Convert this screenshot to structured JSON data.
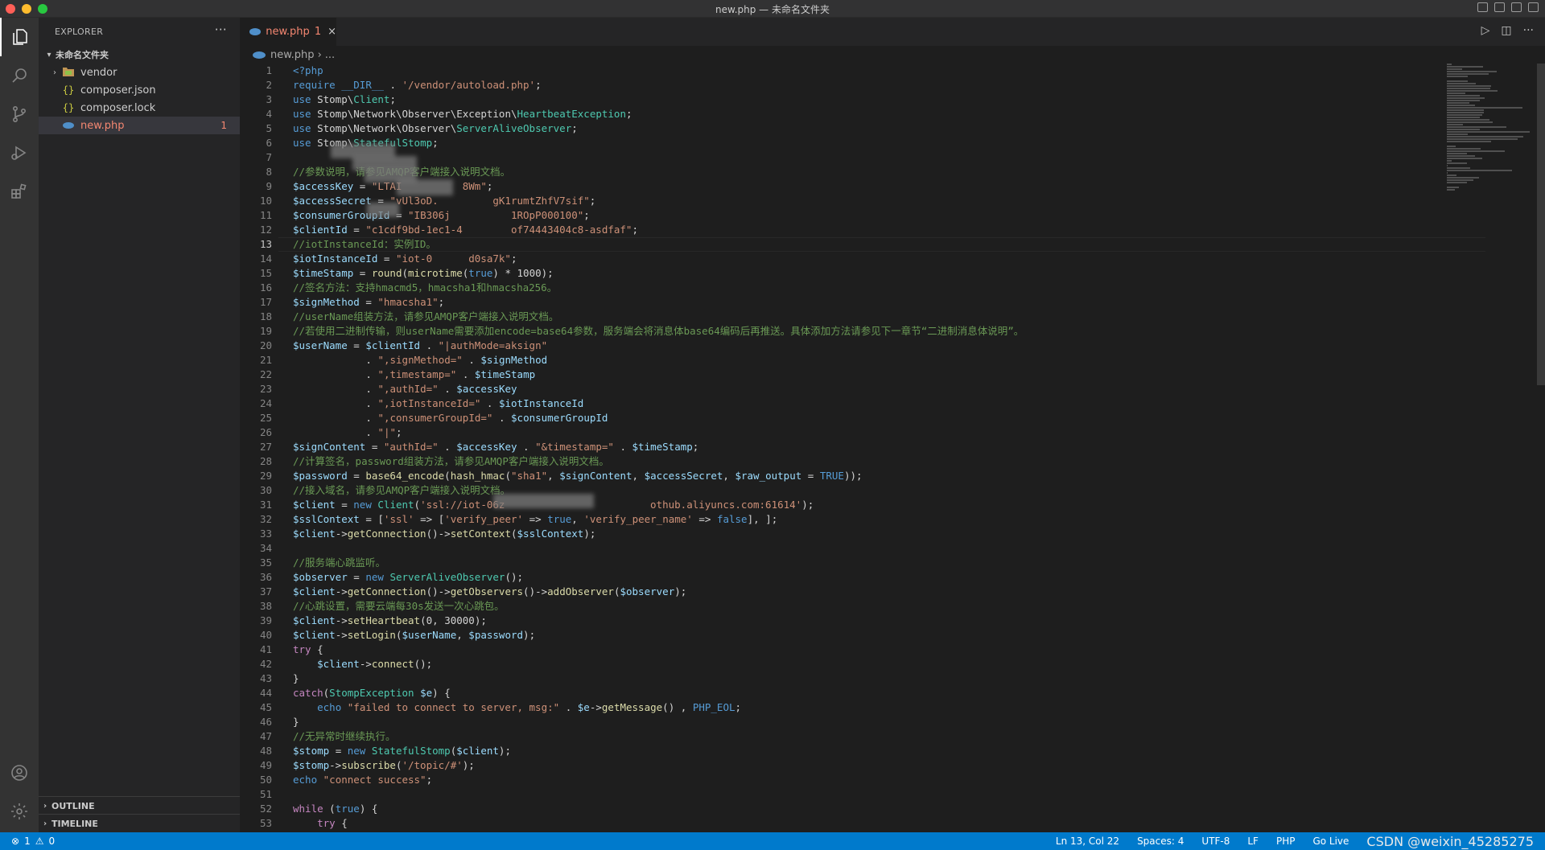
{
  "window": {
    "title": "new.php — 未命名文件夹"
  },
  "explorer": {
    "header": "EXPLORER",
    "more": "···",
    "folder": "未命名文件夹",
    "items": [
      {
        "label": "vendor",
        "type": "folder"
      },
      {
        "label": "composer.json",
        "type": "json"
      },
      {
        "label": "composer.lock",
        "type": "json"
      },
      {
        "label": "new.php",
        "type": "php",
        "badge": "1"
      }
    ],
    "outline": "OUTLINE",
    "timeline": "TIMELINE"
  },
  "tab": {
    "label": "new.php",
    "badge": "1",
    "close": "×"
  },
  "breadcrumb": {
    "file": "new.php",
    "rest": "..."
  },
  "editor": {
    "current_line": 13
  },
  "code": [
    "<?php",
    "require __DIR__ . '/vendor/autoload.php';",
    "use Stomp\\Client;",
    "use Stomp\\Network\\Observer\\Exception\\HeartbeatException;",
    "use Stomp\\Network\\Observer\\ServerAliveObserver;",
    "use Stomp\\StatefulStomp;",
    "",
    "//参数说明，请参见AMQP客户端接入说明文档。",
    "$accessKey = \"LTAI          8Wm\";",
    "$accessSecret = \"vUl3oD.         gK1rumtZhfV7sif\";",
    "$consumerGroupId = \"IB306j          1ROpP000100\";",
    "$clientId = \"c1cdf9bd-1ec1-4        of74443404c8-asdfaf\";",
    "//iotInstanceId：实例ID。",
    "$iotInstanceId = \"iot-0      d0sa7k\";",
    "$timeStamp = round(microtime(true) * 1000);",
    "//签名方法：支持hmacmd5，hmacsha1和hmacsha256。",
    "$signMethod = \"hmacsha1\";",
    "//userName组装方法，请参见AMQP客户端接入说明文档。",
    "//若使用二进制传输，则userName需要添加encode=base64参数，服务端会将消息体base64编码后再推送。具体添加方法请参见下一章节“二进制消息体说明”。",
    "$userName = $clientId . \"|authMode=aksign\"",
    "            . \",signMethod=\" . $signMethod",
    "            . \",timestamp=\" . $timeStamp",
    "            . \",authId=\" . $accessKey",
    "            . \",iotInstanceId=\" . $iotInstanceId",
    "            . \",consumerGroupId=\" . $consumerGroupId",
    "            . \"|\";",
    "$signContent = \"authId=\" . $accessKey . \"&timestamp=\" . $timeStamp;",
    "//计算签名，password组装方法，请参见AMQP客户端接入说明文档。",
    "$password = base64_encode(hash_hmac(\"sha1\", $signContent, $accessSecret, $raw_output = TRUE));",
    "//接入域名，请参见AMQP客户端接入说明文档。",
    "$client = new Client('ssl://iot-06z                        othub.aliyuncs.com:61614');",
    "$sslContext = ['ssl' => ['verify_peer' => true, 'verify_peer_name' => false], ];",
    "$client->getConnection()->setContext($sslContext);",
    "",
    "//服务端心跳监听。",
    "$observer = new ServerAliveObserver();",
    "$client->getConnection()->getObservers()->addObserver($observer);",
    "//心跳设置，需要云端每30s发送一次心跳包。",
    "$client->setHeartbeat(0, 30000);",
    "$client->setLogin($userName, $password);",
    "try {",
    "    $client->connect();",
    "}",
    "catch(StompException $e) {",
    "    echo \"failed to connect to server, msg:\" . $e->getMessage() , PHP_EOL;",
    "}",
    "//无异常时继续执行。",
    "$stomp = new StatefulStomp($client);",
    "$stomp->subscribe('/topic/#');",
    "echo \"connect success\";",
    "",
    "while (true) {",
    "    try {"
  ],
  "status": {
    "errors": "1",
    "warnings": "0",
    "position": "Ln 13, Col 22",
    "spaces": "Spaces: 4",
    "encoding": "UTF-8",
    "eol": "LF",
    "language": "PHP",
    "golive": "Go Live",
    "watermark": "CSDN @weixin_45285275"
  }
}
